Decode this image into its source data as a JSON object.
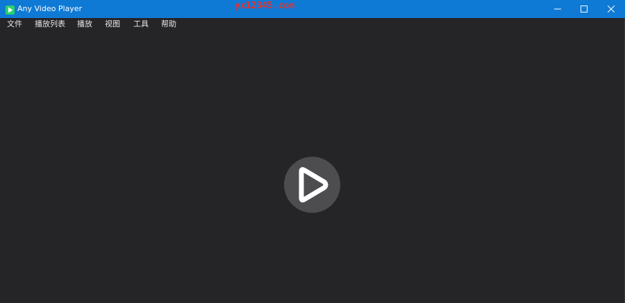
{
  "window": {
    "title": "Any Video Player",
    "watermark": "yx12345.com",
    "app_icon": "play-triangle-icon",
    "controls": {
      "minimize_icon": "minimize-icon",
      "maximize_icon": "maximize-icon",
      "close_icon": "close-icon"
    }
  },
  "menu": {
    "items": [
      {
        "label": "文件"
      },
      {
        "label": "播放列表"
      },
      {
        "label": "播放"
      },
      {
        "label": "视图"
      },
      {
        "label": "工具"
      },
      {
        "label": "帮助"
      }
    ]
  },
  "player": {
    "center_icon": "play-icon"
  },
  "colors": {
    "titlebar": "#0f7ad5",
    "background": "#252427",
    "play_circle": "#4d4c4f",
    "watermark": "#e8312e",
    "app_icon": "#2bd26a"
  }
}
